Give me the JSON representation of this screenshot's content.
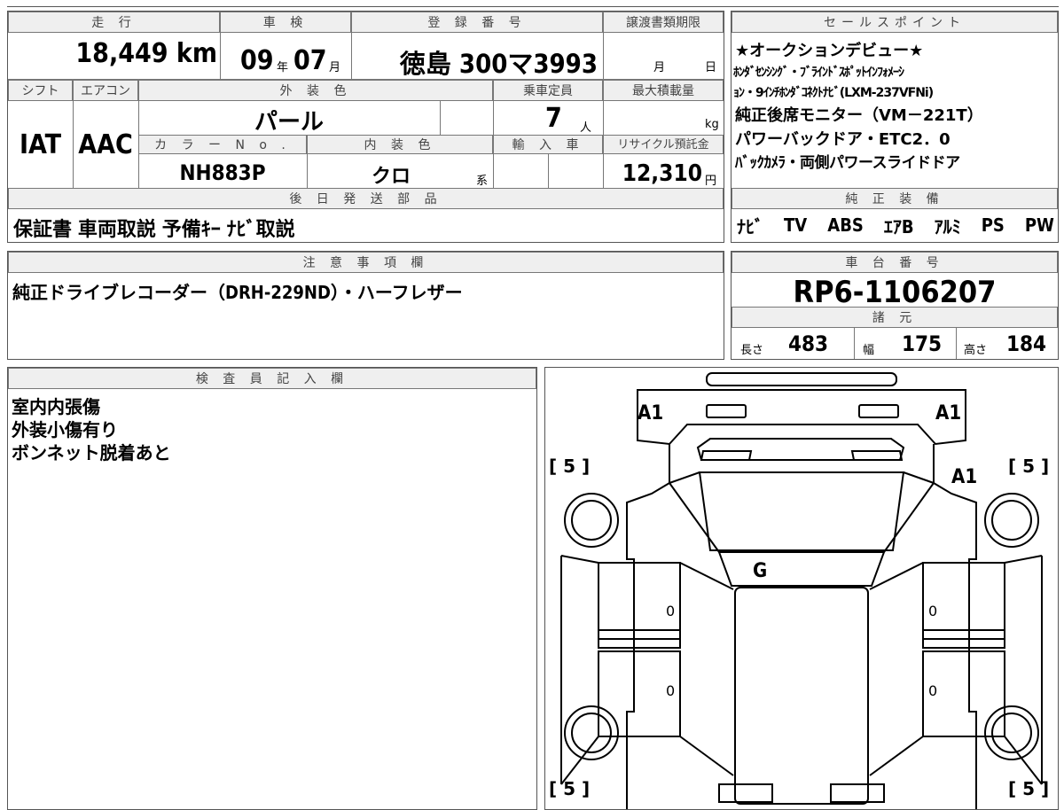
{
  "top": {
    "headers": {
      "mileage": "走 行",
      "inspection": "車 検",
      "registration": "登 録 番 号",
      "transfer_deadline": "譲渡書類期限",
      "shift": "シフト",
      "aircon": "エアコン",
      "exterior_color": "外 装 色",
      "capacity": "乗車定員",
      "max_load": "最大積載量",
      "color_no": "カ ラ ー N o .",
      "interior_color": "内 装 色",
      "import": "輸 入 車",
      "recycle": "リサイクル預託金",
      "later_parts": "後 日 発 送 部 品"
    },
    "mileage": "18,449 km",
    "inspection_year": "09",
    "year_unit": "年",
    "inspection_month": "07",
    "month_unit": "月",
    "registration": "徳島 300マ3993",
    "deadline_month_unit": "月",
    "deadline_day_unit": "日",
    "shift": "IAT",
    "aircon": "AAC",
    "exterior_color": "パール",
    "capacity": "7",
    "capacity_unit": "人",
    "load_unit": "kg",
    "color_no": "NH883P",
    "interior_color": "クロ",
    "interior_suffix": "系",
    "recycle_fee": "12,310",
    "recycle_unit": "円",
    "later_parts": "保証書 車両取説 予備ｷｰ ﾅﾋﾞ取説"
  },
  "sales": {
    "header": "セールスポイント",
    "lines": [
      "★オークションデビュー★",
      "ﾎﾝﾀﾞｾﾝｼﾝｸﾞ・ﾌﾞﾗｲﾝﾄﾞｽﾎﾟｯﾄｲﾝﾌｫﾒｰｼ",
      "ｮﾝ・9ｲﾝﾁﾎﾝﾀﾞｺﾈｸﾄﾅﾋﾞ(LXM-237VFNi)",
      "純正後席モニター（VM－221T）",
      "パワーバックドア・ETC2．0",
      "ﾊﾞｯｸｶﾒﾗ・両側パワースライドドア"
    ],
    "equip_header": "純 正 装 備",
    "equipment": [
      "ﾅﾋﾞ",
      "TV",
      "ABS",
      "ｴｱB",
      "ｱﾙﾐ",
      "PS",
      "PW"
    ]
  },
  "notes": {
    "header": "注 意 事 項 欄",
    "text": "純正ドライブレコーダー（DRH-229ND）・ハーフレザー"
  },
  "chassis": {
    "header": "車 台 番 号",
    "number": "RP6-1106207",
    "spec_header": "諸 元",
    "length_label": "長さ",
    "length": "483",
    "width_label": "幅",
    "width": "175",
    "height_label": "高さ",
    "height": "184"
  },
  "inspector": {
    "header": "検 査 員 記 入 欄",
    "lines": [
      "室内内張傷",
      "外装小傷有り",
      "ボンネット脱着あと"
    ]
  },
  "diagram": {
    "marks": {
      "front_left": "A1",
      "front_right": "A1",
      "right_fender": "A1",
      "hood": "G"
    },
    "wheel_label_tl": "[ 5 ]",
    "wheel_label_tr": "[ 5 ]",
    "wheel_label_bl": "[ 5 ]",
    "wheel_label_br": "[ 5 ]",
    "zero": "0"
  }
}
